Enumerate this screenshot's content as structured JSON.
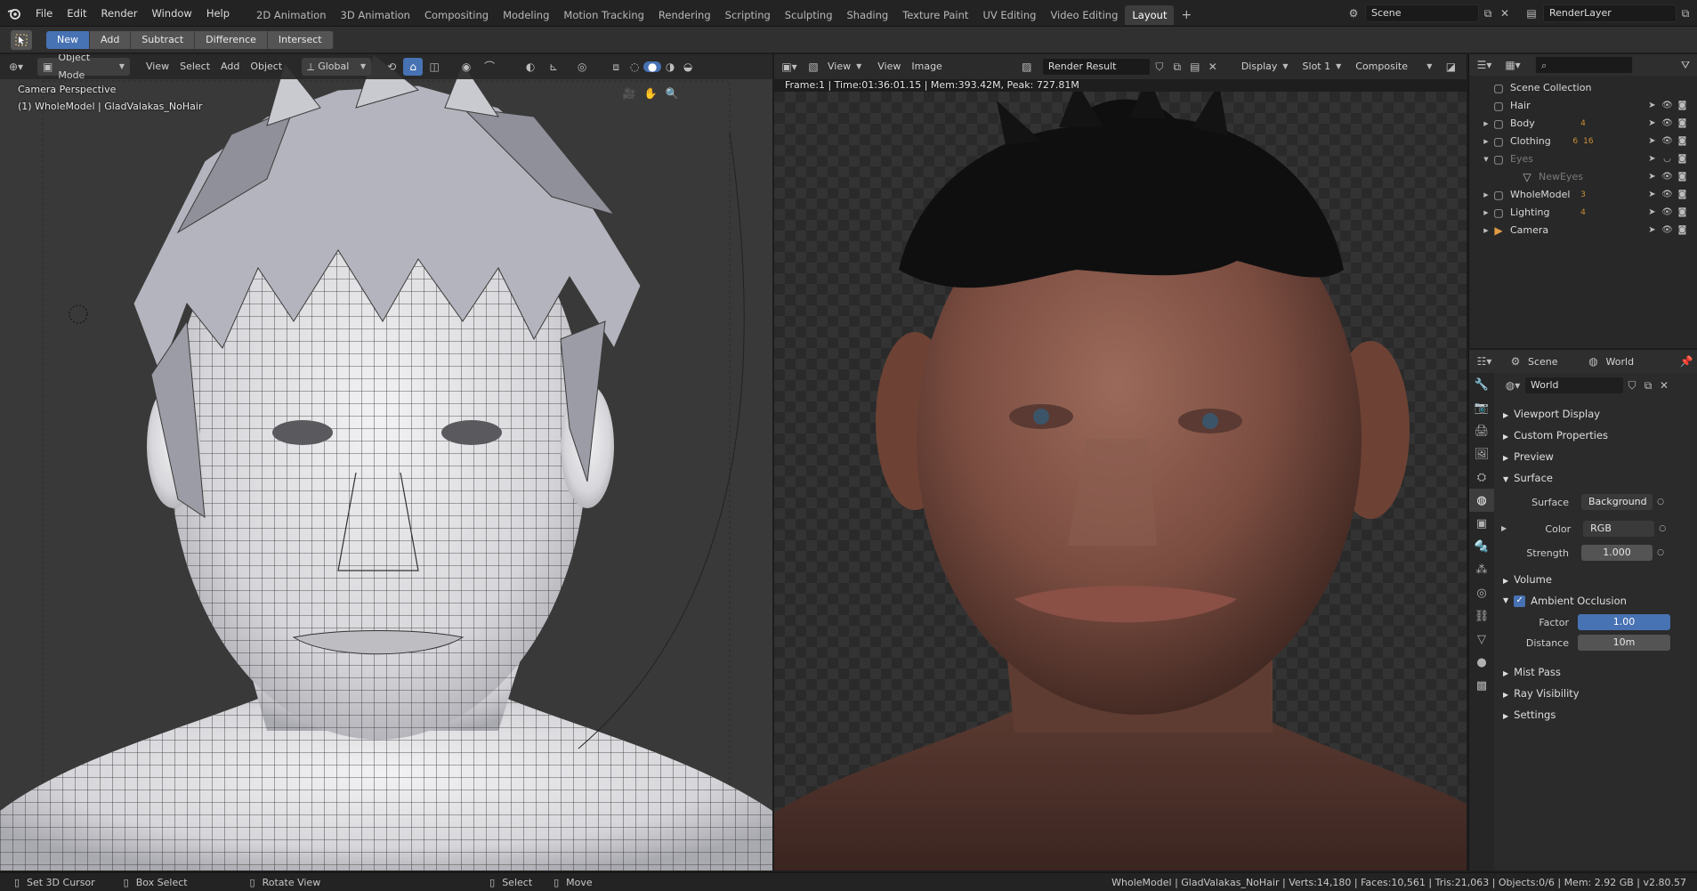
{
  "topbar": {
    "menus": [
      "File",
      "Edit",
      "Render",
      "Window",
      "Help"
    ],
    "workspaces": [
      "2D Animation",
      "3D Animation",
      "Compositing",
      "Modeling",
      "Motion Tracking",
      "Rendering",
      "Scripting",
      "Sculpting",
      "Shading",
      "Texture Paint",
      "UV Editing",
      "Video Editing",
      "Layout"
    ],
    "active_workspace": "Layout",
    "add_tab": "+",
    "scene_name": "Scene",
    "render_layer": "RenderLayer"
  },
  "toolbar2": {
    "modes": [
      "New",
      "Add",
      "Subtract",
      "Difference",
      "Intersect"
    ],
    "active_mode": "New"
  },
  "viewport": {
    "header": {
      "mode": "Object Mode",
      "menus": [
        "View",
        "Select",
        "Add",
        "Object"
      ],
      "transform_orientation": "Global"
    },
    "overlay_title": "Camera Perspective",
    "overlay_object": "(1) WholeModel | GladValakas_NoHair"
  },
  "render": {
    "header": {
      "menus": [
        "View",
        "View",
        "Image"
      ],
      "image_name": "Render Result",
      "display": "Display",
      "slot": "Slot 1",
      "composite": "Composite"
    },
    "info": "Frame:1 | Time:01:36:01.15 | Mem:393.42M, Peak: 727.81M"
  },
  "outliner": {
    "root": "Scene Collection",
    "items": [
      {
        "name": "Hair",
        "badge": "",
        "dim": false,
        "indent": 1
      },
      {
        "name": "Body",
        "badge": "4",
        "dim": false,
        "indent": 1
      },
      {
        "name": "Clothing",
        "badge": "16",
        "badge2": "6",
        "dim": false,
        "indent": 1
      },
      {
        "name": "Eyes",
        "badge": "",
        "dim": true,
        "indent": 1
      },
      {
        "name": "NewEyes",
        "badge": "",
        "dim": true,
        "indent": 2
      },
      {
        "name": "WholeModel",
        "badge": "3",
        "dim": false,
        "indent": 1
      },
      {
        "name": "Lighting",
        "badge": "4",
        "dim": false,
        "indent": 1
      },
      {
        "name": "Camera",
        "badge": "",
        "dim": false,
        "indent": 1
      }
    ]
  },
  "properties": {
    "breadcrumb_scene": "Scene",
    "breadcrumb_world": "World",
    "world_name": "World",
    "panels": {
      "viewport_display": "Viewport Display",
      "custom_properties": "Custom Properties",
      "preview": "Preview",
      "surface": "Surface",
      "volume": "Volume",
      "ambient_occlusion": "Ambient Occlusion",
      "mist_pass": "Mist Pass",
      "ray_visibility": "Ray Visibility",
      "settings": "Settings"
    },
    "surface": {
      "surface_label": "Surface",
      "surface_value": "Background",
      "color_label": "Color",
      "color_value": "RGB",
      "strength_label": "Strength",
      "strength_value": "1.000"
    },
    "ao": {
      "factor_label": "Factor",
      "factor_value": "1.00",
      "distance_label": "Distance",
      "distance_value": "10m"
    }
  },
  "status": {
    "items": [
      "Set 3D Cursor",
      "Box Select",
      "Rotate View",
      "Select",
      "Move"
    ],
    "stats": "WholeModel | GladValakas_NoHair | Verts:14,180 | Faces:10,561 | Tris:21,063 | Objects:0/6 | Mem: 2.92 GB | v2.80.57"
  },
  "colors": {
    "accent": "#4772b3",
    "bg": "#1d1d1d",
    "panel": "#2b2b2b"
  }
}
